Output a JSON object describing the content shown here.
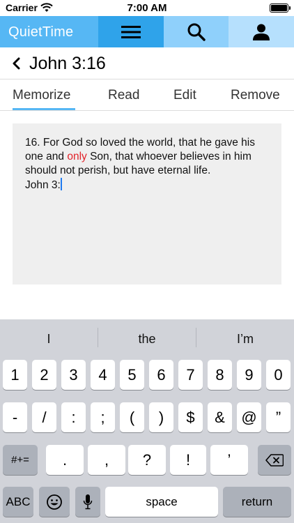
{
  "status": {
    "carrier": "Carrier",
    "time": "7:00 AM"
  },
  "appbar": {
    "brand": "QuietTime"
  },
  "title": "John 3:16",
  "tabs": [
    "Memorize",
    "Read",
    "Edit",
    "Remove"
  ],
  "verse": {
    "part1": "16. For God so loved the world, that he gave his one and ",
    "highlight": "only",
    "part2": " Son, that whoever believes in him should not perish, but have eternal life.",
    "line2": "John 3:"
  },
  "keyboard": {
    "suggestions": [
      "I",
      "the",
      "I’m"
    ],
    "row1": [
      "1",
      "2",
      "3",
      "4",
      "5",
      "6",
      "7",
      "8",
      "9",
      "0"
    ],
    "row2": [
      "-",
      "/",
      ":",
      ";",
      "(",
      ")",
      "$",
      "&",
      "@",
      "”"
    ],
    "row3": {
      "mode": "#+=",
      "keys": [
        ".",
        ",",
        "?",
        "!",
        "’"
      ]
    },
    "row4": {
      "abc": "ABC",
      "space": "space",
      "return": "return"
    }
  },
  "colors": {
    "brand": "#56b7f4",
    "menu": "#2fa3ea",
    "search": "#8fd0fb",
    "user": "#b6e0fd",
    "highlight": "#e2232a",
    "caret": "#1f7af0"
  }
}
